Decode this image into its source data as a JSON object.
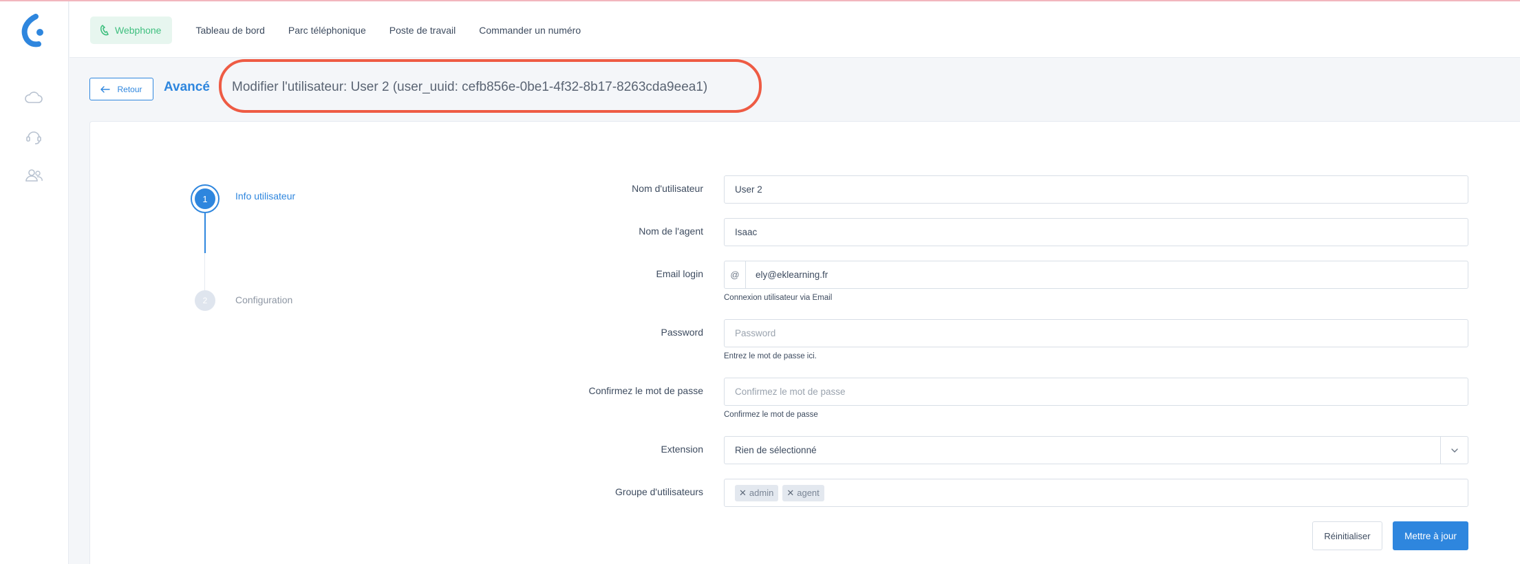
{
  "nav": {
    "webphone": "Webphone",
    "dashboard": "Tableau de bord",
    "phone_park": "Parc téléphonique",
    "workstation": "Poste de travail",
    "order_number": "Commander un numéro"
  },
  "header": {
    "back_label": "Retour",
    "section": "Avancé",
    "title": "Modifier l'utilisateur: User 2 (user_uuid: cefb856e-0be1-4f32-8b17-8263cda9eea1)"
  },
  "stepper": {
    "steps": [
      {
        "number": "1",
        "label": "Info utilisateur",
        "state": "active"
      },
      {
        "number": "2",
        "label": "Configuration",
        "state": "inactive"
      }
    ]
  },
  "form": {
    "username": {
      "label": "Nom d'utilisateur",
      "value": "User 2"
    },
    "agent_name": {
      "label": "Nom de l'agent",
      "value": "Isaac"
    },
    "email": {
      "label": "Email login",
      "prefix": "@",
      "value": "ely@eklearning.fr",
      "help": "Connexion utilisateur via Email"
    },
    "password": {
      "label": "Password",
      "placeholder": "Password",
      "help": "Entrez le mot de passe ici."
    },
    "confirm_password": {
      "label": "Confirmez le mot de passe",
      "placeholder": "Confirmez le mot de passe",
      "help": "Confirmez le mot de passe"
    },
    "extension": {
      "label": "Extension",
      "value": "Rien de sélectionné"
    },
    "user_groups": {
      "label": "Groupe d'utilisateurs",
      "tags": [
        "admin",
        "agent"
      ]
    }
  },
  "actions": {
    "reset_label": "Réinitialiser",
    "update_label": "Mettre à jour"
  },
  "colors": {
    "primary": "#2e86de",
    "webphone_green": "#3fbf7f",
    "highlight": "#ee5b44"
  }
}
